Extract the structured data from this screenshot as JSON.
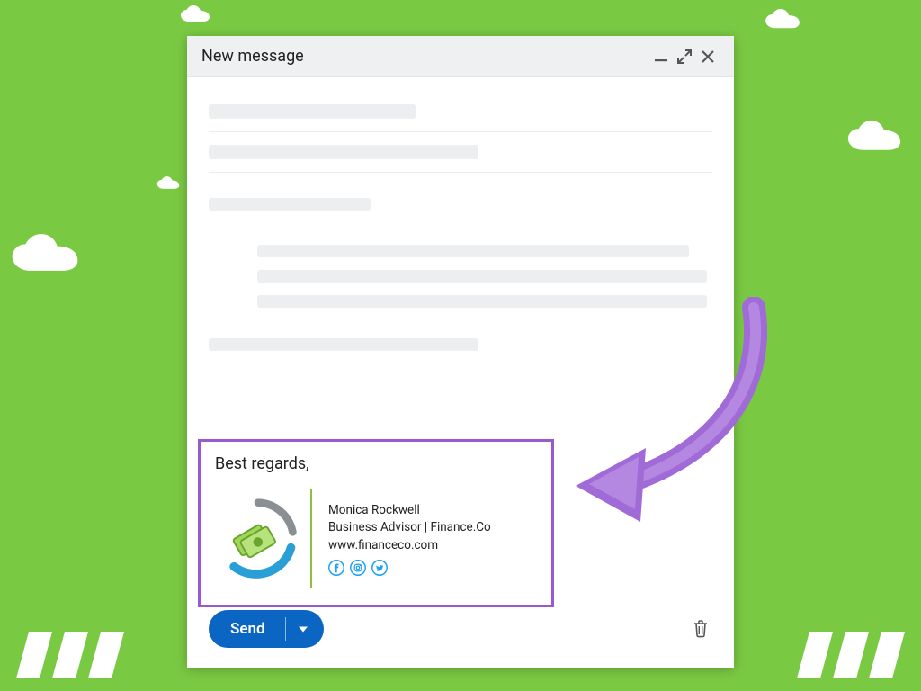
{
  "compose": {
    "title": "New message",
    "send_label": "Send"
  },
  "signature": {
    "greeting": "Best regards,",
    "name": "Monica Rockwell",
    "title": "Business Advisor | Finance.Co",
    "url": "www.financeco.com",
    "social": {
      "facebook": "facebook-icon",
      "instagram": "instagram-icon",
      "twitter": "twitter-icon"
    }
  },
  "colors": {
    "background": "#7ac943",
    "highlight_border": "#9b59d0",
    "send_button": "#0a66c2",
    "social_icon": "#1da1f2",
    "logo_green": "#8fbf3f",
    "logo_blue": "#2a9fd6",
    "logo_grey": "#8a8f94"
  }
}
